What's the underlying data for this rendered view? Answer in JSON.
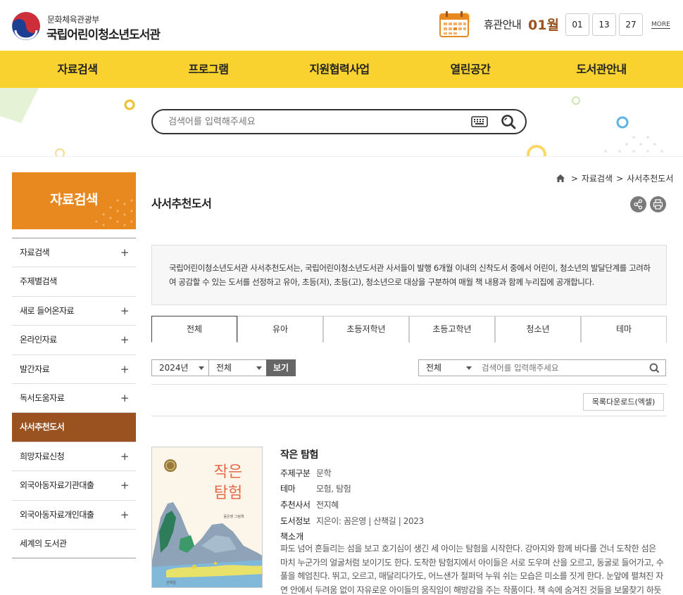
{
  "header": {
    "ministry": "문화체육관광부",
    "library_name": "국립어린이청소년도서관",
    "closing_label": "휴관안내",
    "closing_month": "01월",
    "closing_days": [
      "01",
      "13",
      "27"
    ],
    "more_label": "MORE"
  },
  "gnb": [
    "자료검색",
    "프로그램",
    "지원협력사업",
    "열린공간",
    "도서관안내"
  ],
  "main_search": {
    "placeholder": "검색어를 입력해주세요"
  },
  "lnb": {
    "title": "자료검색",
    "items": [
      {
        "label": "자료검색",
        "plus": "+"
      },
      {
        "label": "주제별검색",
        "plus": ""
      },
      {
        "label": "새로 들어온자료",
        "plus": "+"
      },
      {
        "label": "온라인자료",
        "plus": "+"
      },
      {
        "label": "발간자료",
        "plus": "+"
      },
      {
        "label": "독서도움자료",
        "plus": "+"
      },
      {
        "label": "사서추천도서",
        "plus": "",
        "active": true
      },
      {
        "label": "희망자료신청",
        "plus": "+"
      },
      {
        "label": "외국아동자료기관대출",
        "plus": "+"
      },
      {
        "label": "외국아동자료개인대출",
        "plus": "+"
      },
      {
        "label": "세계의 도서관",
        "plus": ""
      }
    ]
  },
  "breadcrumb": {
    "sep": ">",
    "level1": "자료검색",
    "level2": "사서추천도서"
  },
  "page_title": "사서추천도서",
  "intro": "국립어린이청소년도서관 사서추천도서는, 국립어린이청소년도서관 사서들이 발행 6개월 이내의 신착도서 중에서 어린이, 청소년의 발달단계를 고려하여 공감할 수 있는 도서를 선정하고 유아, 초등(저), 초등(고), 청소년으로 대상을 구분하여 매월 책 내용과 함께 누리집에 공개합니다.",
  "tabs": [
    "전체",
    "유아",
    "초등저학년",
    "초등고학년",
    "청소년",
    "테마"
  ],
  "filters": {
    "year": "2024년",
    "month": "전체",
    "view_button": "보기",
    "search_field": "전체",
    "search_placeholder": "검색어를 입력해주세요",
    "excel_button": "목록다운로드(엑셀)"
  },
  "book": {
    "cover_title": "작은 탐험",
    "cover_author": "꼼은영 그림책",
    "cover_publisher": "산책길",
    "title": "작은 탐험",
    "rows": [
      {
        "k": "주제구분",
        "v": "문학"
      },
      {
        "k": "테마",
        "v": "모험, 탐험"
      },
      {
        "k": "추천사서",
        "v": "전지혜"
      },
      {
        "k": "도서정보",
        "v": "지은이: 꼼은영 | 산책길 | 2023"
      }
    ],
    "intro_label": "책소개",
    "intro_text": "파도 넘어 흔들리는 섬을 보고 호기심이 생긴 세 아이는 탐험을 시작한다. 강아지와 함께 바다를 건너 도착한 섬은 마치 누군가의 얼굴처럼 보이기도 한다. 도착한 탐험지에서 아이들은 서로 도우며 산을 오르고, 동굴로 들어가고, 수풀을 헤엄친다. 뛰고, 오르고, 매달리다가도, 어느샌가 철퍼덕 누워 쉬는 모습은 미소를 짓게 한다. 눈앞에 펼쳐진 자연 안에서 두려움 없이 자유로운 아이들의 움직임이 해방감을 주는 작품이다. 책 속에 숨겨진 것들을 보물찾기 하듯 찾아보는 것"
  },
  "colors": {
    "accent": "#f9d230",
    "lnb_title": "#e8891f",
    "active": "#9a5220"
  }
}
